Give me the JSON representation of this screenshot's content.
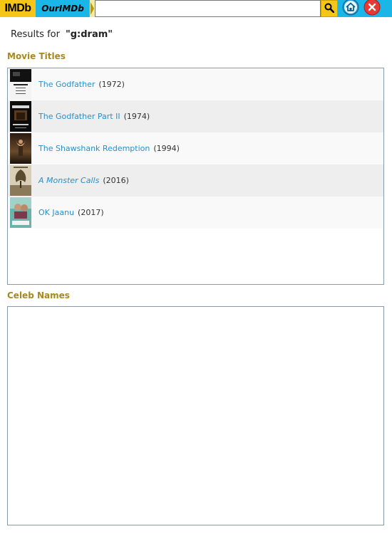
{
  "header": {
    "logo_text": "IMDb",
    "app_name": "OurIMDb",
    "search": {
      "value": "",
      "placeholder": ""
    },
    "icons": {
      "search": "search-icon",
      "home": "home-icon",
      "close": "close-icon"
    },
    "colors": {
      "bar": "#1ab6e8",
      "logo": "#f5c518",
      "close": "#e53935",
      "home": "#1a9ad6"
    }
  },
  "results": {
    "label": "Results for",
    "query": "\"g:dram\""
  },
  "sections": {
    "movies_title": "Movie Titles",
    "celebs_title": "Celeb Names"
  },
  "movies": [
    {
      "title": "The Godfather",
      "year": "(1972)"
    },
    {
      "title": "The Godfather Part II",
      "year": "(1974)"
    },
    {
      "title": "The Shawshank Redemption",
      "year": "(1994)"
    },
    {
      "title": "A Monster Calls",
      "year": "(2016)"
    },
    {
      "title": "OK Jaanu",
      "year": "(2017)"
    }
  ],
  "celebs": []
}
